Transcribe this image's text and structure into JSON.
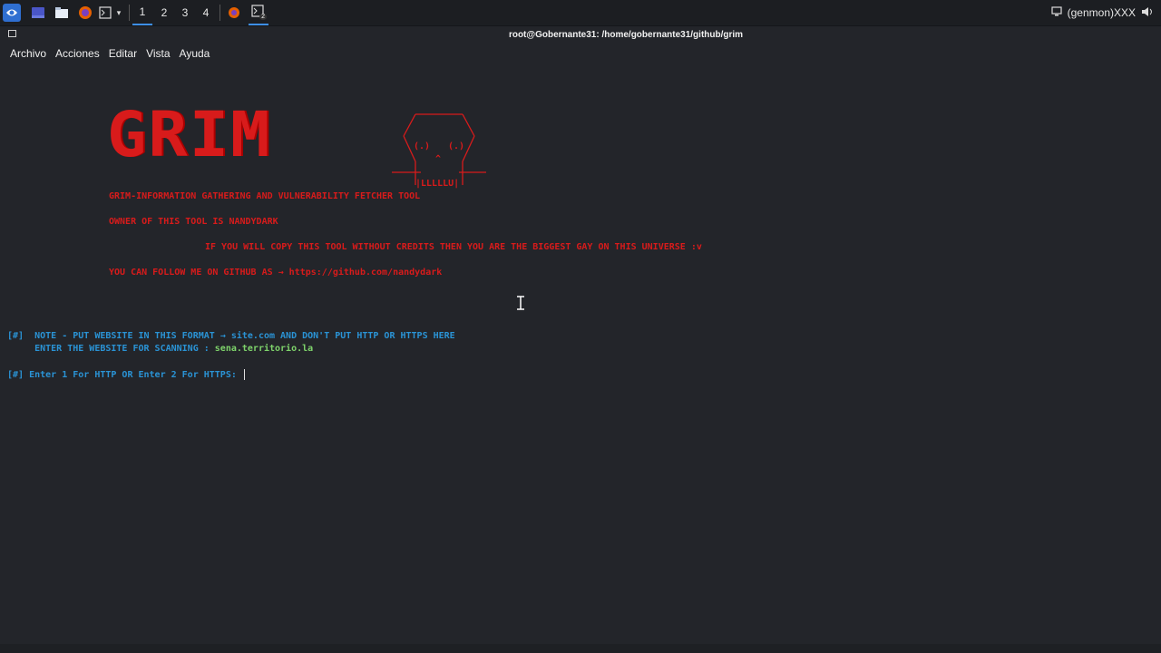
{
  "panel": {
    "workspaces": [
      "1",
      "2",
      "3",
      "4"
    ],
    "tray_label": "(genmon)XXX",
    "terminal_badge": "2"
  },
  "window": {
    "title": "root@Gobernante31: /home/gobernante31/github/grim"
  },
  "menu": [
    "Archivo",
    "Acciones",
    "Editar",
    "Vista",
    "Ayuda"
  ],
  "terminal": {
    "banner_logo": "GRIM",
    "skull_text": "|LLLLLU|",
    "lines": [
      "GRIM-INFORMATION GATHERING AND VULNERABILITY FETCHER TOOL",
      "OWNER OF THIS TOOL IS NANDYDARK",
      "IF YOU WILL COPY THIS TOOL WITHOUT CREDITS THEN YOU ARE THE BIGGEST GAY ON THIS UNIVERSE :v",
      "YOU CAN FOLLOW ME ON GITHUB AS → https://github.com/nandydark"
    ],
    "note_prefix": "[#]  NOTE - PUT WEBSITE IN THIS FORMAT → ",
    "note_site": "site.com",
    "note_suffix": " AND DON'T PUT HTTP OR HTTPS HERE",
    "scan_prompt": "     ENTER THE WEBSITE FOR SCANNING : ",
    "scan_value": "sena.territorio.la",
    "protocol_prompt": "[#] Enter 1 For HTTP OR Enter 2 For HTTPS: "
  },
  "colors": {
    "background": "#23252a",
    "banner_red": "#d81b1b",
    "prompt_blue": "#2a93d5",
    "value_green": "#7ed36b"
  }
}
